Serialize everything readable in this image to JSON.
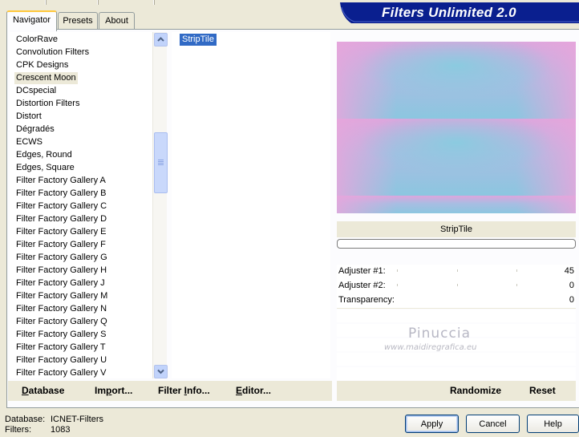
{
  "tabs": [
    {
      "label": "Navigator",
      "active": true
    },
    {
      "label": "Presets",
      "active": false
    },
    {
      "label": "About",
      "active": false
    }
  ],
  "banner": {
    "title": "Filters Unlimited 2.0",
    "color": "#0a1f8f"
  },
  "categories": {
    "selected": "Crescent Moon",
    "items": [
      "ColorRave",
      "Convolution Filters",
      "CPK Designs",
      "Crescent Moon",
      "DCspecial",
      "Distortion Filters",
      "Distort",
      "Dégradés",
      "ECWS",
      "Edges, Round",
      "Edges, Square",
      "Filter Factory Gallery A",
      "Filter Factory Gallery B",
      "Filter Factory Gallery C",
      "Filter Factory Gallery D",
      "Filter Factory Gallery E",
      "Filter Factory Gallery F",
      "Filter Factory Gallery G",
      "Filter Factory Gallery H",
      "Filter Factory Gallery J",
      "Filter Factory Gallery M",
      "Filter Factory Gallery N",
      "Filter Factory Gallery Q",
      "Filter Factory Gallery S",
      "Filter Factory Gallery T",
      "Filter Factory Gallery U",
      "Filter Factory Gallery V"
    ]
  },
  "filters": {
    "items": [
      "StripTile"
    ],
    "selected": "StripTile",
    "highlight_color": "#316ac5"
  },
  "preview": {
    "filter_name": "StripTile",
    "colors": [
      "#e5a6dd",
      "#8ecbe0",
      "#b5b8e4"
    ]
  },
  "adjusters": [
    {
      "label": "Adjuster #1:",
      "value": "45"
    },
    {
      "label": "Adjuster #2:",
      "value": "0"
    },
    {
      "label": "Transparency:",
      "value": "0"
    }
  ],
  "watermark": {
    "line1": "Pinuccia",
    "line2": "www.maidiregrafica.eu"
  },
  "left_actions": {
    "database": {
      "accel": "D",
      "rest": "atabase"
    },
    "import": {
      "pre": "Im",
      "accel": "p",
      "rest": "ort..."
    },
    "filter_info": {
      "pre": "Filter ",
      "accel": "I",
      "rest": "nfo..."
    },
    "editor": {
      "accel": "E",
      "rest": "ditor..."
    }
  },
  "right_actions": {
    "randomize": "Randomize",
    "reset": "Reset"
  },
  "status": {
    "database_label": "Database:",
    "database_value": "ICNET-Filters",
    "filters_label": "Filters:",
    "filters_value": "1083"
  },
  "dialog": {
    "apply": "Apply",
    "cancel": "Cancel",
    "help": "Help"
  }
}
